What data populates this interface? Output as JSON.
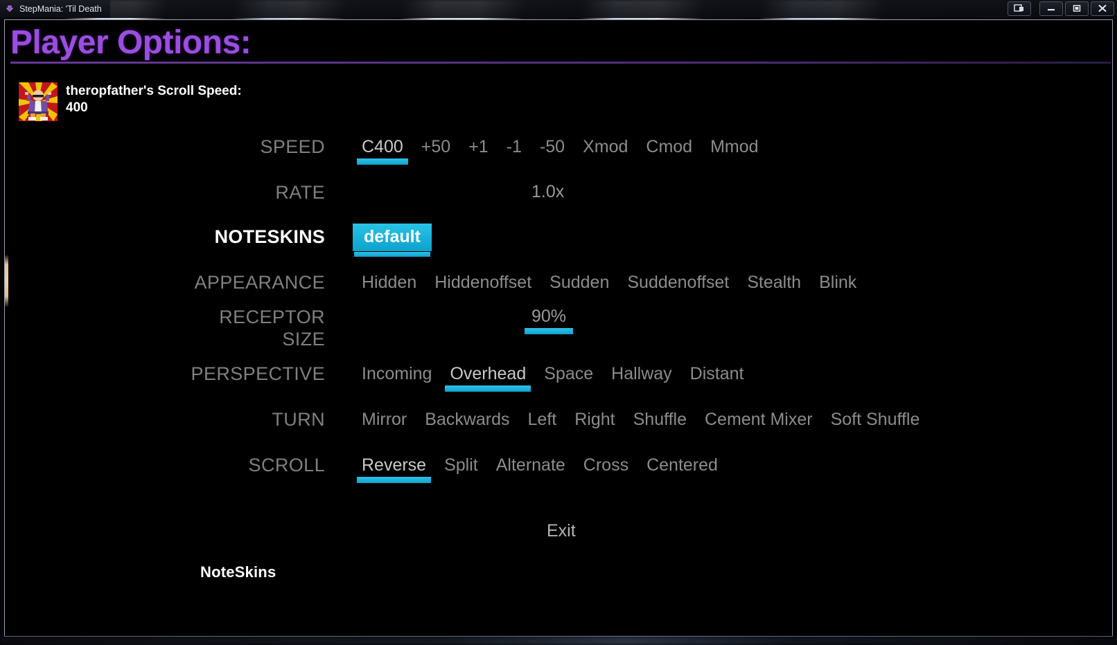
{
  "window": {
    "title": "StepMania: 'Til Death",
    "icon": "stepmania-arrow-icon",
    "controls": [
      {
        "name": "aero-peek-button",
        "glyph": "restore-window-icon"
      },
      {
        "name": "minimize-button",
        "glyph": "minimize-icon"
      },
      {
        "name": "maximize-button",
        "glyph": "maximize-icon"
      },
      {
        "name": "close-button",
        "glyph": "close-icon"
      }
    ]
  },
  "screen": {
    "title": "Player Options:",
    "title_color": "#9b4de0",
    "accent_color": "#16a8d0",
    "background_color": "#000000",
    "dim_text_color": "#808080",
    "active_text_color": "#ffffff"
  },
  "player": {
    "avatar_name": "player-avatar-sprite",
    "speed_label": "theropfather's Scroll Speed:",
    "speed_value": "400"
  },
  "options": [
    {
      "label": "SPEED",
      "focused": false,
      "type": "choices",
      "choices": [
        {
          "label": "C400",
          "selected": true
        },
        {
          "label": "+50",
          "selected": false
        },
        {
          "label": "+1",
          "selected": false
        },
        {
          "label": "-1",
          "selected": false
        },
        {
          "label": "-50",
          "selected": false
        },
        {
          "label": "Xmod",
          "selected": false
        },
        {
          "label": "Cmod",
          "selected": false
        },
        {
          "label": "Mmod",
          "selected": false
        }
      ]
    },
    {
      "label": "RATE",
      "focused": false,
      "type": "value",
      "value": "1.0x",
      "underlined": false
    },
    {
      "label": "NOTESKINS",
      "focused": true,
      "type": "choices",
      "choices": [
        {
          "label": "default",
          "selected": true,
          "boxed": true
        }
      ]
    },
    {
      "label": "APPEARANCE",
      "focused": false,
      "type": "choices",
      "choices": [
        {
          "label": "Hidden",
          "selected": false
        },
        {
          "label": "Hiddenoffset",
          "selected": false
        },
        {
          "label": "Sudden",
          "selected": false
        },
        {
          "label": "Suddenoffset",
          "selected": false
        },
        {
          "label": "Stealth",
          "selected": false
        },
        {
          "label": "Blink",
          "selected": false
        }
      ]
    },
    {
      "label": "RECEPTOR\nSIZE",
      "focused": false,
      "type": "value",
      "value": "90%",
      "underlined": true
    },
    {
      "label": "PERSPECTIVE",
      "focused": false,
      "type": "choices",
      "choices": [
        {
          "label": "Incoming",
          "selected": false
        },
        {
          "label": "Overhead",
          "selected": true
        },
        {
          "label": "Space",
          "selected": false
        },
        {
          "label": "Hallway",
          "selected": false
        },
        {
          "label": "Distant",
          "selected": false
        }
      ]
    },
    {
      "label": "TURN",
      "focused": false,
      "type": "choices",
      "choices": [
        {
          "label": "Mirror",
          "selected": false
        },
        {
          "label": "Backwards",
          "selected": false
        },
        {
          "label": "Left",
          "selected": false
        },
        {
          "label": "Right",
          "selected": false
        },
        {
          "label": "Shuffle",
          "selected": false
        },
        {
          "label": "Cement Mixer",
          "selected": false
        },
        {
          "label": "Soft Shuffle",
          "selected": false
        }
      ]
    },
    {
      "label": "SCROLL",
      "focused": false,
      "type": "choices",
      "choices": [
        {
          "label": "Reverse",
          "selected": true
        },
        {
          "label": "Split",
          "selected": false
        },
        {
          "label": "Alternate",
          "selected": false
        },
        {
          "label": "Cross",
          "selected": false
        },
        {
          "label": "Centered",
          "selected": false
        }
      ]
    }
  ],
  "exit": {
    "label": "Exit"
  },
  "footer": {
    "section_label": "NoteSkins"
  }
}
